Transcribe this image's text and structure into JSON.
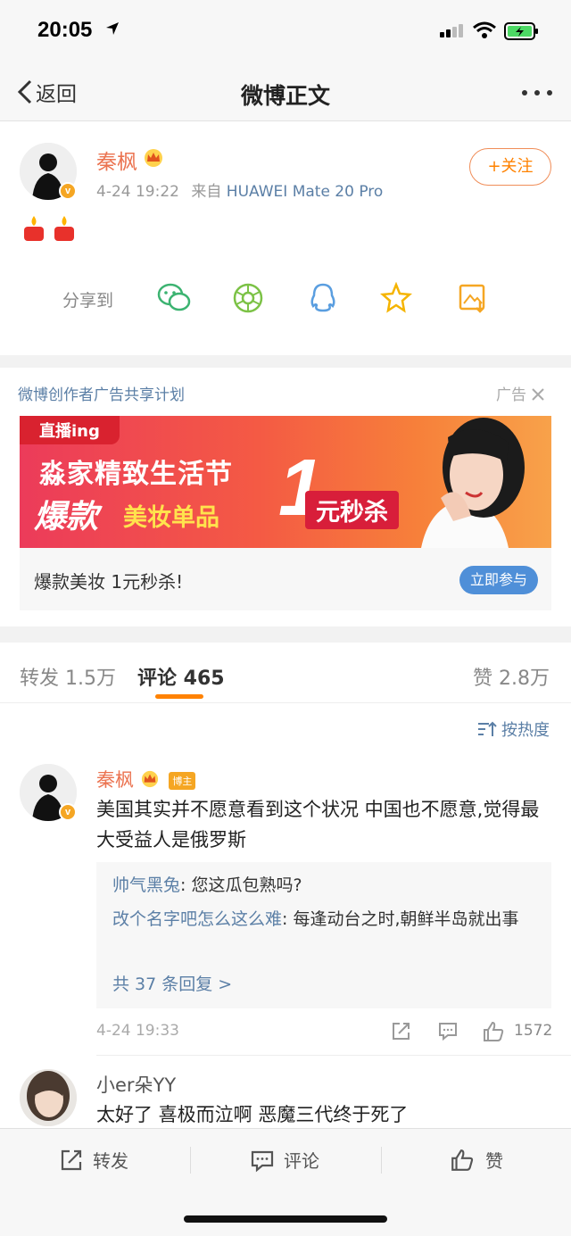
{
  "status_bar": {
    "time": "20:05"
  },
  "nav": {
    "back_label": "返回",
    "title": "微博正文"
  },
  "post": {
    "author": "秦枫",
    "time": "4-24 19:22",
    "source_prefix": "来自",
    "source_device": "HUAWEI Mate 20 Pro",
    "follow_label": "+关注",
    "content_emoji": "🕯🕯",
    "share_label": "分享到",
    "share_targets": [
      "wechat-icon",
      "moments-icon",
      "qq-icon",
      "qzone-icon",
      "save-image-icon"
    ]
  },
  "ad": {
    "plan_label": "微博创作者广告共享计划",
    "ad_tag": "广告",
    "banner": {
      "live": "直播ing",
      "line1": "淼家精致生活节",
      "hot": "爆款",
      "makeup": "美妆单品",
      "one": "1",
      "yuan": "元秒杀"
    },
    "caption": "爆款美妆 1元秒杀!",
    "cta": "立即参与"
  },
  "tabs": {
    "repost": "转发 1.5万",
    "comments": "评论 465",
    "likes": "赞 2.8万"
  },
  "sort_label": "按热度",
  "comments": [
    {
      "author": "秦枫",
      "badge": "博主",
      "text": "美国其实并不愿意看到这个状况 中国也不愿意,觉得最大受益人是俄罗斯",
      "replies": [
        {
          "user": "帅气黑兔",
          "text": ": 您这瓜包熟吗?"
        },
        {
          "user": "改个名字吧怎么这么难",
          "text": ": 每逢动台之时,朝鲜半岛就出事"
        }
      ],
      "more_replies": "共 37 条回复 >",
      "time": "4-24 19:33",
      "like_count": "1572"
    },
    {
      "author": "小er朵YY",
      "text": "太好了 喜极而泣啊 恶魔三代终于死了"
    }
  ],
  "bottom_bar": {
    "repost": "转发",
    "comment": "评论",
    "like": "赞"
  },
  "colors": {
    "orange": "#ff8200",
    "link": "#5b7fa6",
    "name": "#eb7350"
  }
}
